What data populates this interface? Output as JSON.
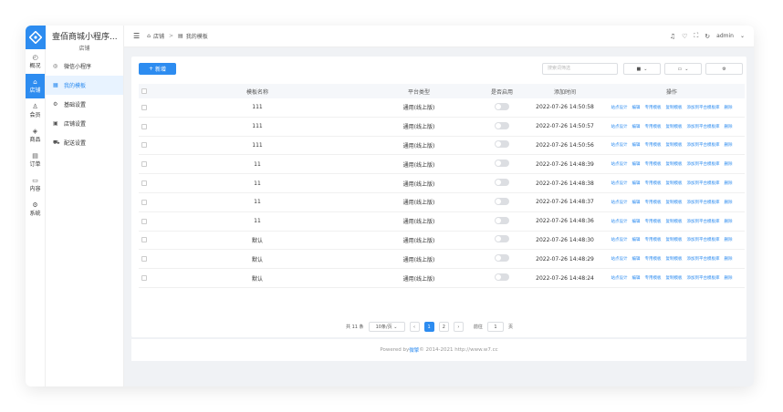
{
  "app": {
    "shop_name": "壹佰商城小程序...",
    "shop_sub": "店铺"
  },
  "leftnav": [
    {
      "label": "概况",
      "icon": "dashboard-icon"
    },
    {
      "label": "店铺",
      "icon": "store-icon"
    },
    {
      "label": "会员",
      "icon": "user-icon"
    },
    {
      "label": "商品",
      "icon": "box-icon"
    },
    {
      "label": "订单",
      "icon": "order-icon"
    },
    {
      "label": "内容",
      "icon": "folder-icon"
    },
    {
      "label": "系统",
      "icon": "gear-icon"
    }
  ],
  "subnav": [
    {
      "label": "微信小程序",
      "icon": "wechat-icon"
    },
    {
      "label": "我的模板",
      "icon": "template-icon"
    },
    {
      "label": "基础设置",
      "icon": "settings-icon"
    },
    {
      "label": "店铺设置",
      "icon": "shop-settings-icon"
    },
    {
      "label": "配送设置",
      "icon": "truck-icon"
    }
  ],
  "header": {
    "crumb1": "店铺",
    "crumb_sep": ">",
    "crumb2": "我的模板",
    "user": "admin"
  },
  "toolbar": {
    "add_label": "新增",
    "search_placeholder": "搜索词筛选"
  },
  "table": {
    "headers": {
      "name": "模板名称",
      "type": "平台类型",
      "enabled": "是否启用",
      "time": "添加时间",
      "ops": "操作"
    },
    "ops": [
      "站点设计",
      "编辑",
      "专用模板",
      "复制模板",
      "添加到平台模板库",
      "删除"
    ],
    "rows": [
      {
        "name": "111",
        "type": "通用(线上版)",
        "time": "2022-07-26 14:50:58"
      },
      {
        "name": "111",
        "type": "通用(线上版)",
        "time": "2022-07-26 14:50:57"
      },
      {
        "name": "111",
        "type": "通用(线上版)",
        "time": "2022-07-26 14:50:56"
      },
      {
        "name": "11",
        "type": "通用(线上版)",
        "time": "2022-07-26 14:48:39"
      },
      {
        "name": "11",
        "type": "通用(线上版)",
        "time": "2022-07-26 14:48:38"
      },
      {
        "name": "11",
        "type": "通用(线上版)",
        "time": "2022-07-26 14:48:37"
      },
      {
        "name": "11",
        "type": "通用(线上版)",
        "time": "2022-07-26 14:48:36"
      },
      {
        "name": "默认",
        "type": "通用(线上版)",
        "time": "2022-07-26 14:48:30"
      },
      {
        "name": "默认",
        "type": "通用(线上版)",
        "time": "2022-07-26 14:48:29"
      },
      {
        "name": "默认",
        "type": "通用(线上版)",
        "time": "2022-07-26 14:48:24"
      }
    ]
  },
  "pager": {
    "total": "共 11 条",
    "per_page": "10条/页",
    "prev": "‹",
    "p1": "1",
    "p2": "2",
    "next": "›",
    "goto_prefix": "前往",
    "goto_value": "1",
    "goto_suffix": "页"
  },
  "footer": {
    "prefix": "Powered by ",
    "brand": "微擎",
    "suffix": " © 2014-2021 http://www.w7.cc"
  },
  "colors": {
    "accent": "#2d8cf0",
    "bg": "#f0f2f5"
  }
}
